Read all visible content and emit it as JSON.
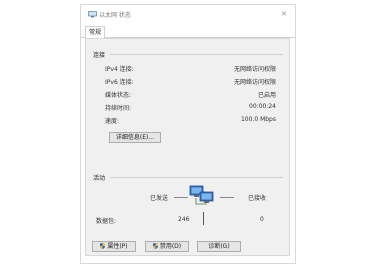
{
  "window": {
    "title": "以太网 状态",
    "close_glyph": "×"
  },
  "tabs": [
    {
      "label": "常规"
    }
  ],
  "connection": {
    "section_label": "连接",
    "rows": [
      {
        "label": "IPv4 连接:",
        "value": "无网络访问权限"
      },
      {
        "label": "IPv6 连接:",
        "value": "无网络访问权限"
      },
      {
        "label": "媒体状态:",
        "value": "已启用"
      },
      {
        "label": "持续时间:",
        "value": "00:00:24"
      },
      {
        "label": "速度:",
        "value": "100.0 Mbps"
      }
    ],
    "details_button": "详细信息(E)..."
  },
  "activity": {
    "section_label": "活动",
    "sent_label": "已发送",
    "received_label": "已接收",
    "bytes_label": "数据包:",
    "sent_value": "246",
    "received_value": "0"
  },
  "buttons": {
    "properties": "属性(P)",
    "disable": "禁用(D)",
    "diagnose": "诊断(G)"
  },
  "icons": {
    "title": "network-adapter-icon",
    "activity": "network-computers-icon",
    "shield": "uac-shield-icon"
  }
}
